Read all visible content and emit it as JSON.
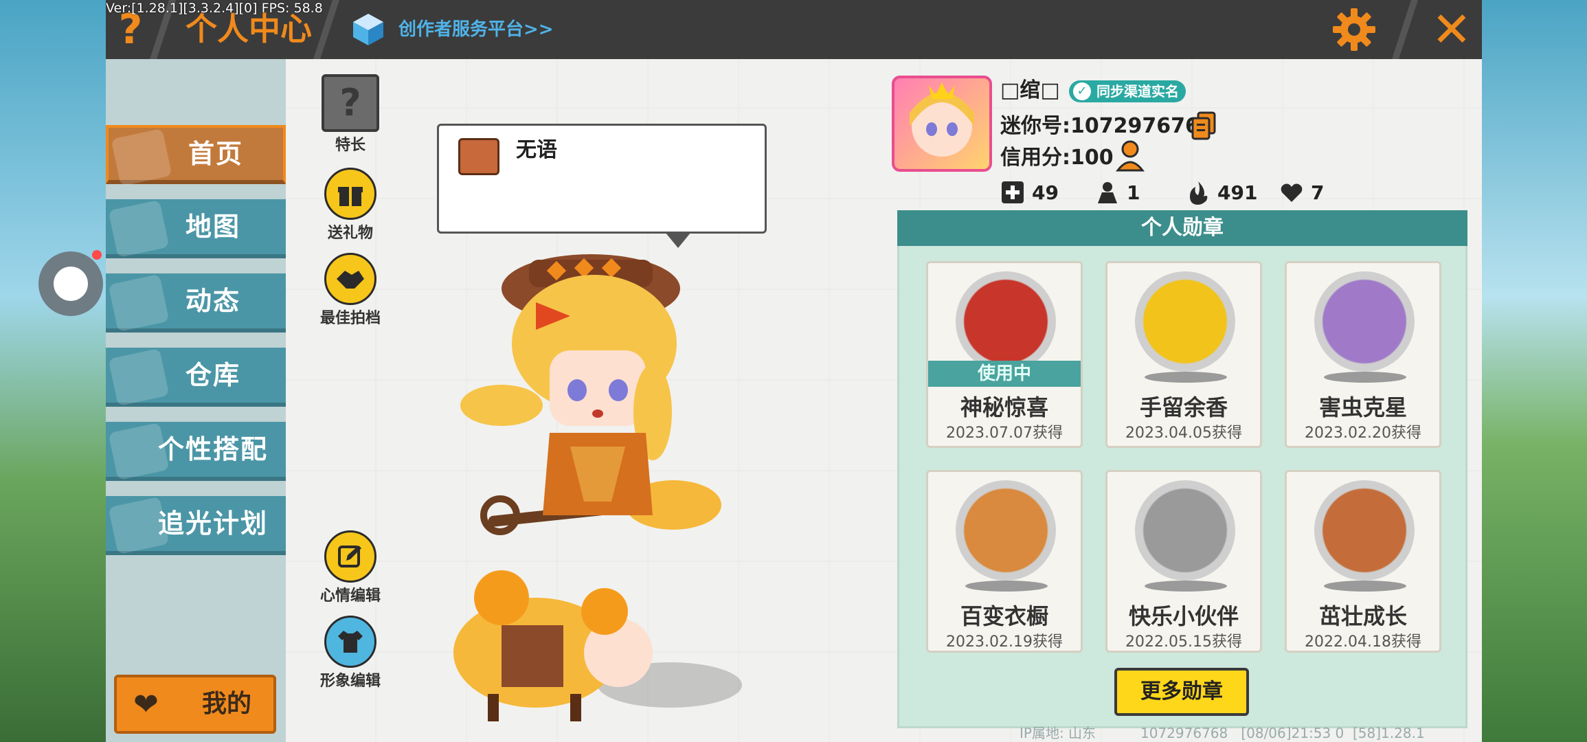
{
  "app": {
    "version_text": "Ver:[1.28.1][3.3.2.4][0] FPS: 58.8"
  },
  "topbar": {
    "title": "个人中心",
    "creator_link": "创作者服务平台>>"
  },
  "sidebar": {
    "items": [
      {
        "label": "首页",
        "active": true
      },
      {
        "label": "地图",
        "active": false
      },
      {
        "label": "动态",
        "active": false
      },
      {
        "label": "仓库",
        "active": false
      },
      {
        "label": "个性搭配",
        "active": false
      },
      {
        "label": "追光计划",
        "active": false
      }
    ],
    "mine_label": "我的"
  },
  "actions": {
    "specialty": "特长",
    "gift": "送礼物",
    "best_photo": "最佳拍档",
    "mood_edit": "心情编辑",
    "avatar_edit": "形象编辑"
  },
  "bubble": {
    "text": "无语"
  },
  "profile": {
    "nickname": "□绾□",
    "verify_badge": "同步渠道实名",
    "mini_id": "迷你号:1072976768",
    "credit": "信用分:100",
    "stats": {
      "friends": "49",
      "fans": "1",
      "popularity": "491",
      "likes": "7"
    }
  },
  "badges": {
    "header": "个人勋章",
    "in_use_label": "使用中",
    "items": [
      {
        "name": "神秘惊喜",
        "date": "2023.07.07获得",
        "in_use": true,
        "color": "#c8352a"
      },
      {
        "name": "手留余香",
        "date": "2023.04.05获得",
        "in_use": false,
        "color": "#f2c31a"
      },
      {
        "name": "害虫克星",
        "date": "2023.02.20获得",
        "in_use": false,
        "color": "#a07ac9"
      },
      {
        "name": "百变衣橱",
        "date": "2023.02.19获得",
        "in_use": false,
        "color": "#d98a3e"
      },
      {
        "name": "快乐小伙伴",
        "date": "2022.05.15获得",
        "in_use": false,
        "color": "#9a9a9a"
      },
      {
        "name": "茁壮成长",
        "date": "2022.04.18获得",
        "in_use": false,
        "color": "#c46d3a"
      }
    ],
    "more_label": "更多勋章"
  },
  "footer": {
    "ip_location": "IP属地: 山东",
    "info": "1072976768   [08/06]21:53 0  [58]1.28.1"
  },
  "colors": {
    "accent_orange": "#f08a1c",
    "teal": "#3c8e8c",
    "nav_blue": "#4b96a6"
  }
}
